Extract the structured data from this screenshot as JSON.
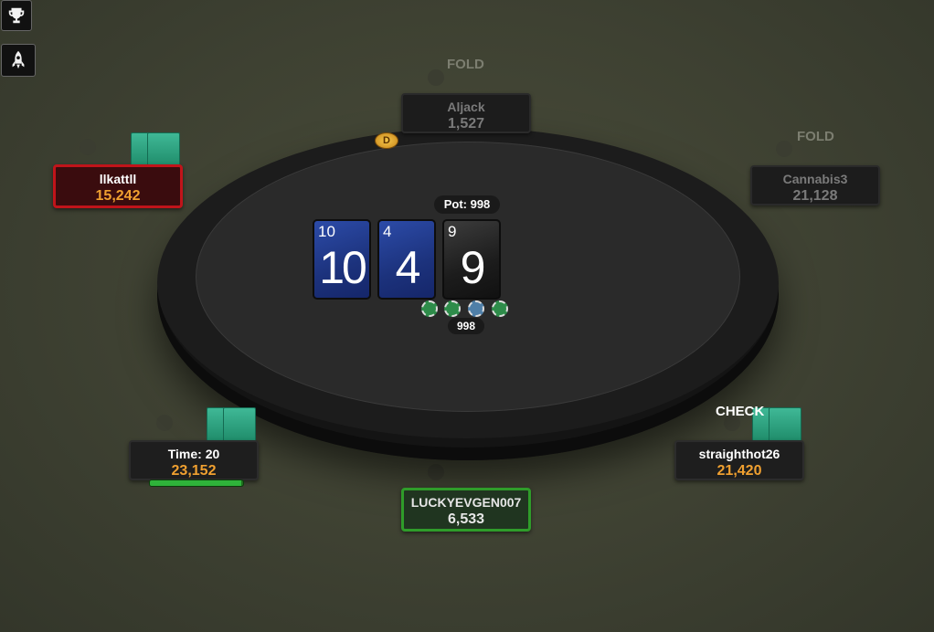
{
  "toolbar": {
    "trophy_icon": "trophy-icon",
    "rocket_icon": "rocket-icon"
  },
  "pot": {
    "label": "Pot: 998"
  },
  "board": [
    {
      "rank_small": "10",
      "rank_big": "10",
      "color": "blue"
    },
    {
      "rank_small": "4",
      "rank_big": "4",
      "color": "blue"
    },
    {
      "rank_small": "9",
      "rank_big": "9",
      "color": "black"
    }
  ],
  "bet": {
    "amount": "998"
  },
  "dealer_button": "D",
  "players": {
    "top": {
      "name": "Aljack",
      "stack": "1,527",
      "action": "FOLD"
    },
    "right_top": {
      "name": "Cannabis3",
      "stack": "21,128",
      "action": "FOLD"
    },
    "left_top": {
      "name": "llkattll",
      "stack": "15,242"
    },
    "left_bottom": {
      "name": "Time: 20",
      "stack": "23,152",
      "timer_fraction": 0.98
    },
    "right_bottom": {
      "name": "straighthot26",
      "stack": "21,420",
      "action": "CHECK"
    },
    "hero": {
      "name": "LUCKYEVGEN007",
      "stack": "6,533"
    }
  },
  "colors": {
    "stack_orange": "#f0a030",
    "active_border": "#c0141a",
    "hero_border": "#2f9c2a",
    "card_back": "#2fa880"
  }
}
